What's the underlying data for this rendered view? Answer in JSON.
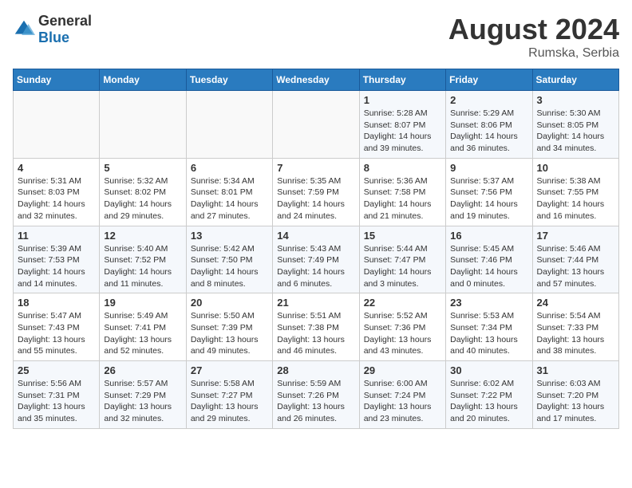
{
  "logo": {
    "general": "General",
    "blue": "Blue"
  },
  "title": "August 2024",
  "subtitle": "Rumska, Serbia",
  "weekdays": [
    "Sunday",
    "Monday",
    "Tuesday",
    "Wednesday",
    "Thursday",
    "Friday",
    "Saturday"
  ],
  "weeks": [
    [
      {
        "day": "",
        "info": ""
      },
      {
        "day": "",
        "info": ""
      },
      {
        "day": "",
        "info": ""
      },
      {
        "day": "",
        "info": ""
      },
      {
        "day": "1",
        "info": "Sunrise: 5:28 AM\nSunset: 8:07 PM\nDaylight: 14 hours and 39 minutes."
      },
      {
        "day": "2",
        "info": "Sunrise: 5:29 AM\nSunset: 8:06 PM\nDaylight: 14 hours and 36 minutes."
      },
      {
        "day": "3",
        "info": "Sunrise: 5:30 AM\nSunset: 8:05 PM\nDaylight: 14 hours and 34 minutes."
      }
    ],
    [
      {
        "day": "4",
        "info": "Sunrise: 5:31 AM\nSunset: 8:03 PM\nDaylight: 14 hours and 32 minutes."
      },
      {
        "day": "5",
        "info": "Sunrise: 5:32 AM\nSunset: 8:02 PM\nDaylight: 14 hours and 29 minutes."
      },
      {
        "day": "6",
        "info": "Sunrise: 5:34 AM\nSunset: 8:01 PM\nDaylight: 14 hours and 27 minutes."
      },
      {
        "day": "7",
        "info": "Sunrise: 5:35 AM\nSunset: 7:59 PM\nDaylight: 14 hours and 24 minutes."
      },
      {
        "day": "8",
        "info": "Sunrise: 5:36 AM\nSunset: 7:58 PM\nDaylight: 14 hours and 21 minutes."
      },
      {
        "day": "9",
        "info": "Sunrise: 5:37 AM\nSunset: 7:56 PM\nDaylight: 14 hours and 19 minutes."
      },
      {
        "day": "10",
        "info": "Sunrise: 5:38 AM\nSunset: 7:55 PM\nDaylight: 14 hours and 16 minutes."
      }
    ],
    [
      {
        "day": "11",
        "info": "Sunrise: 5:39 AM\nSunset: 7:53 PM\nDaylight: 14 hours and 14 minutes."
      },
      {
        "day": "12",
        "info": "Sunrise: 5:40 AM\nSunset: 7:52 PM\nDaylight: 14 hours and 11 minutes."
      },
      {
        "day": "13",
        "info": "Sunrise: 5:42 AM\nSunset: 7:50 PM\nDaylight: 14 hours and 8 minutes."
      },
      {
        "day": "14",
        "info": "Sunrise: 5:43 AM\nSunset: 7:49 PM\nDaylight: 14 hours and 6 minutes."
      },
      {
        "day": "15",
        "info": "Sunrise: 5:44 AM\nSunset: 7:47 PM\nDaylight: 14 hours and 3 minutes."
      },
      {
        "day": "16",
        "info": "Sunrise: 5:45 AM\nSunset: 7:46 PM\nDaylight: 14 hours and 0 minutes."
      },
      {
        "day": "17",
        "info": "Sunrise: 5:46 AM\nSunset: 7:44 PM\nDaylight: 13 hours and 57 minutes."
      }
    ],
    [
      {
        "day": "18",
        "info": "Sunrise: 5:47 AM\nSunset: 7:43 PM\nDaylight: 13 hours and 55 minutes."
      },
      {
        "day": "19",
        "info": "Sunrise: 5:49 AM\nSunset: 7:41 PM\nDaylight: 13 hours and 52 minutes."
      },
      {
        "day": "20",
        "info": "Sunrise: 5:50 AM\nSunset: 7:39 PM\nDaylight: 13 hours and 49 minutes."
      },
      {
        "day": "21",
        "info": "Sunrise: 5:51 AM\nSunset: 7:38 PM\nDaylight: 13 hours and 46 minutes."
      },
      {
        "day": "22",
        "info": "Sunrise: 5:52 AM\nSunset: 7:36 PM\nDaylight: 13 hours and 43 minutes."
      },
      {
        "day": "23",
        "info": "Sunrise: 5:53 AM\nSunset: 7:34 PM\nDaylight: 13 hours and 40 minutes."
      },
      {
        "day": "24",
        "info": "Sunrise: 5:54 AM\nSunset: 7:33 PM\nDaylight: 13 hours and 38 minutes."
      }
    ],
    [
      {
        "day": "25",
        "info": "Sunrise: 5:56 AM\nSunset: 7:31 PM\nDaylight: 13 hours and 35 minutes."
      },
      {
        "day": "26",
        "info": "Sunrise: 5:57 AM\nSunset: 7:29 PM\nDaylight: 13 hours and 32 minutes."
      },
      {
        "day": "27",
        "info": "Sunrise: 5:58 AM\nSunset: 7:27 PM\nDaylight: 13 hours and 29 minutes."
      },
      {
        "day": "28",
        "info": "Sunrise: 5:59 AM\nSunset: 7:26 PM\nDaylight: 13 hours and 26 minutes."
      },
      {
        "day": "29",
        "info": "Sunrise: 6:00 AM\nSunset: 7:24 PM\nDaylight: 13 hours and 23 minutes."
      },
      {
        "day": "30",
        "info": "Sunrise: 6:02 AM\nSunset: 7:22 PM\nDaylight: 13 hours and 20 minutes."
      },
      {
        "day": "31",
        "info": "Sunrise: 6:03 AM\nSunset: 7:20 PM\nDaylight: 13 hours and 17 minutes."
      }
    ]
  ]
}
